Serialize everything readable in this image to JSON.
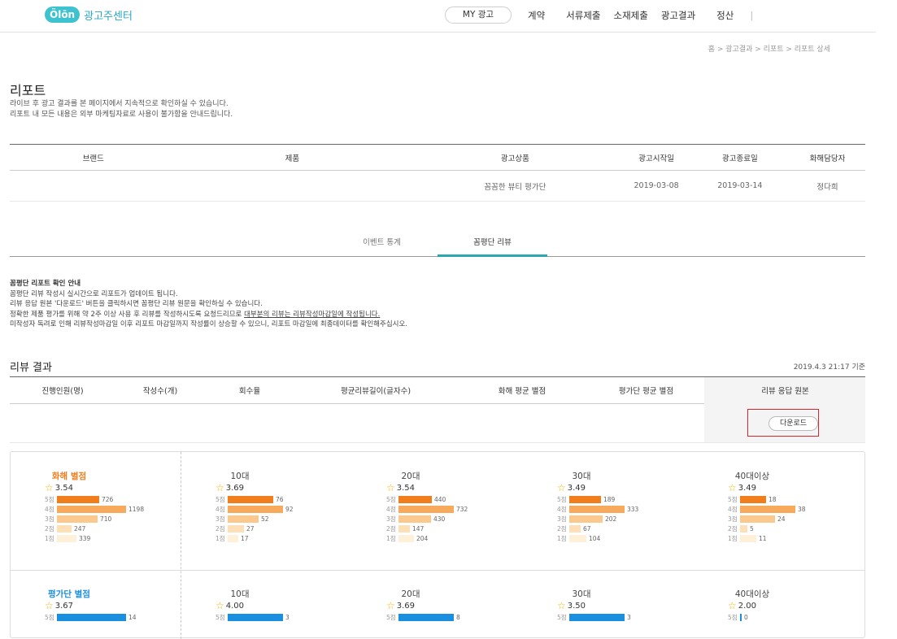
{
  "header": {
    "logo_badge": "Ölōn",
    "logo_text": "광고주센터",
    "nav": {
      "my_ad": "MY 광고",
      "items": [
        "계약",
        "서류제출",
        "소재제출",
        "광고결과",
        "정산"
      ],
      "separator": "|"
    }
  },
  "breadcrumb": "홈  >  광고결과  >  리포트  >  리포트 상세",
  "page": {
    "title": "리포트",
    "desc1": "라이브 후 광고 결과를 본 페이지에서 지속적으로 확인하실 수 있습니다.",
    "desc2": "리포트 내 모든 내용은 외부 마케팅자료로 사용이 불가함을 안내드립니다."
  },
  "info_table": {
    "headers": [
      "브랜드",
      "제품",
      "광고상품",
      "광고시작일",
      "광고종료일",
      "화해담당자"
    ],
    "row": [
      "",
      "",
      "꼼꼼한 뷰티 평가단",
      "2019-03-08",
      "2019-03-14",
      "정다희"
    ]
  },
  "tabs": {
    "event_stats": "이벤트 통계",
    "review": "꼼평단 리뷰"
  },
  "guide": {
    "title": "꼼평단 리포트 확인 안내",
    "line1": "꼼평단 리뷰 작성시 실시간으로 리포트가 업데이트 됩니다.",
    "line2": "리뷰 응답 원본 '다운로드' 버튼을 클릭하시면 꼼평단 리뷰 원문을 확인하실 수 있습니다.",
    "line3a": "정확한 제품 평가를 위해 약 2주 이상 사용 후 리뷰를 작성하시도록 요청드리므로 ",
    "line3b": "대부분의 리뷰는 리뷰작성마감일에 작성됩니다.",
    "line4": "미작성자 독려로 인해 리뷰작성마감일 이후 리포트 마감일까지 작성률이 상승할 수 있으니, 리포트 마감일에 최종데이터를 확인해주십시오."
  },
  "review_result": {
    "title": "리뷰 결과",
    "timestamp": "2019.4.3 21:17 기준",
    "headers": [
      "진행인원(명)",
      "작성수(개)",
      "회수율",
      "평균리뷰길이(글자수)",
      "화해 평균 별점",
      "평가단 평균 별점",
      "리뷰 응답 원본"
    ],
    "download_label": "다운로드"
  },
  "colors": {
    "accent": "#2aa7b0",
    "orange_1": "#f07e1c",
    "orange_2": "#f7a95c",
    "orange_3": "#fbc98d",
    "orange_4": "#fde0b8",
    "orange_5": "#fef0d9",
    "blue": "#1a8fe0",
    "highlight": "#d9262c"
  },
  "hwahae_ratings": {
    "title": "화해 별점",
    "groups": [
      {
        "name": "",
        "avg": "3.54",
        "counts": [
          726,
          1198,
          710,
          247,
          339
        ]
      },
      {
        "name": "10대",
        "avg": "3.69",
        "counts": [
          76,
          92,
          52,
          27,
          17
        ]
      },
      {
        "name": "20대",
        "avg": "3.54",
        "counts": [
          440,
          732,
          430,
          147,
          204
        ]
      },
      {
        "name": "30대",
        "avg": "3.49",
        "counts": [
          189,
          333,
          202,
          67,
          104
        ]
      },
      {
        "name": "40대이상",
        "avg": "3.49",
        "counts": [
          18,
          38,
          24,
          5,
          11
        ]
      }
    ]
  },
  "panel_ratings": {
    "title": "평가단 별점",
    "groups": [
      {
        "name": "",
        "avg": "3.67",
        "counts": [
          14
        ]
      },
      {
        "name": "10대",
        "avg": "4.00",
        "counts": [
          3
        ]
      },
      {
        "name": "20대",
        "avg": "3.69",
        "counts": [
          8
        ]
      },
      {
        "name": "30대",
        "avg": "3.50",
        "counts": [
          3
        ]
      },
      {
        "name": "40대이상",
        "avg": "2.00",
        "counts": [
          0
        ]
      }
    ]
  },
  "score_labels": [
    "5점",
    "4점",
    "3점",
    "2점",
    "1점"
  ]
}
